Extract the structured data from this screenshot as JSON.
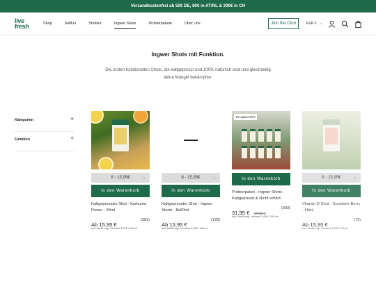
{
  "announcement": "Versandkostenfrei ab 50€ DE, 80€ in AT/NL & 200€ in CH",
  "header": {
    "logo_line1": "live",
    "logo_line2": "fresh",
    "nav": [
      "Shop",
      "Selfkur",
      "Shotkur",
      "Ingwer Shots",
      "Probierpakete",
      "Über Uns"
    ],
    "active_nav": "Ingwer Shots",
    "club_button": "Join the Club",
    "currency": "EUR €"
  },
  "page": {
    "title": "Ingwer Shots mit Funktion.",
    "subtitle": "Die ersten funktionellen Shots, die kaltgepresst und 100% natürlich sind und gleichzeitig deine Mängel bekämpfen."
  },
  "filters": [
    {
      "label": "Kategorien",
      "icon": "plus-icon"
    },
    {
      "label": "Funktion",
      "icon": "plus-icon"
    }
  ],
  "products": [
    {
      "select": "8 - 15,95€",
      "cart": "In den Warenkorb",
      "name": "Kaltgepresster Shot - Kurkuma Power - 60ml",
      "price": "Ab 15,95 €",
      "old_price": "",
      "reviews": "(201)",
      "tax": "inkl. MwSt.zzgl. Versand 3,32€ / 100 ml",
      "badge": ""
    },
    {
      "select": "8 - 15,95€",
      "cart": "In den Warenkorb",
      "name": "Kaltgepresster Shot - Ingwer Sturm - 8x60ml",
      "price": "Ab 15,95 €",
      "old_price": "",
      "reviews": "(178)",
      "tax": "inkl. MwSt.zzgl. Versand 3,32€ / 100 ml",
      "badge": ""
    },
    {
      "select": "",
      "cart": "In den Warenkorb",
      "name": "Probierpaket - Ingwer Shots - Kaltgepresst & Nicht erhitzt.",
      "price": "31,95 €",
      "old_price": "35,55 €",
      "reviews": "(303)",
      "tax": "inkl. MwSt.zzgl. Versand 3,80€ / 100 ml",
      "badge": "Du sparst 10%"
    },
    {
      "select": "8 - 15,95€",
      "cart": "In den Warenkorb",
      "name": "Vitamin D Shot - Sunshine Berry - 60ml",
      "price": "Ab 15,95 €",
      "old_price": "",
      "reviews": "(73)",
      "tax": "inkl. MwSt.zzgl. Versand 3,32€ / 100 ml",
      "badge": ""
    }
  ]
}
